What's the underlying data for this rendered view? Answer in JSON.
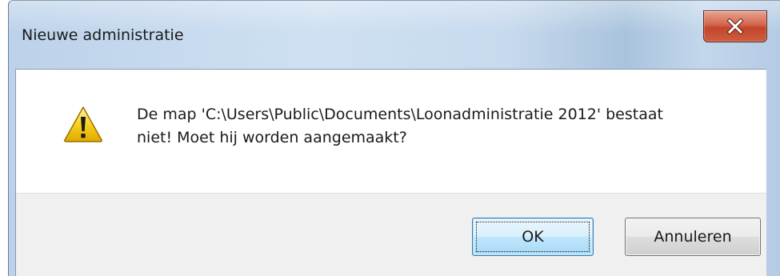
{
  "window": {
    "title": "Nieuwe administratie"
  },
  "titlebar": {
    "close_icon": "close-icon"
  },
  "dialog": {
    "icon": "warning-icon",
    "message_line1": "De map 'C:\\Users\\Public\\Documents\\Loonadministratie 2012' bestaat",
    "message_line2": "niet! Moet hij worden aangemaakt?"
  },
  "buttons": {
    "ok_label": "OK",
    "cancel_label": "Annuleren"
  },
  "colors": {
    "close_button": "#c2452a",
    "warning": "#f5c400",
    "default_button_border": "#3c7fb1"
  }
}
